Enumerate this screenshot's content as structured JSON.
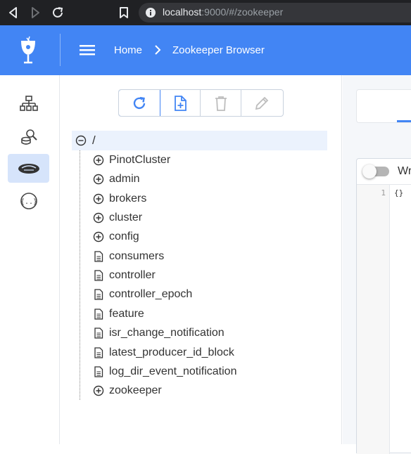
{
  "browser": {
    "url_host": "localhost",
    "url_path": ":9000/#/zookeeper"
  },
  "header": {
    "breadcrumb_home": "Home",
    "breadcrumb_current": "Zookeeper Browser",
    "accent_color": "#4285f4"
  },
  "sidebar": {
    "items": [
      {
        "icon": "cluster-tree-icon",
        "active": false
      },
      {
        "icon": "query-console-icon",
        "active": false
      },
      {
        "icon": "zookeeper-icon",
        "active": true
      },
      {
        "icon": "swagger-api-icon",
        "active": false
      }
    ]
  },
  "toolbar": {
    "buttons": [
      {
        "icon": "refresh-icon",
        "enabled": true
      },
      {
        "icon": "add-file-icon",
        "enabled": true
      },
      {
        "icon": "delete-icon",
        "enabled": false
      },
      {
        "icon": "edit-icon",
        "enabled": false
      }
    ]
  },
  "tree": {
    "root_label": "/",
    "nodes": [
      {
        "label": "PinotCluster",
        "type": "folder"
      },
      {
        "label": "admin",
        "type": "folder"
      },
      {
        "label": "brokers",
        "type": "folder"
      },
      {
        "label": "cluster",
        "type": "folder"
      },
      {
        "label": "config",
        "type": "folder"
      },
      {
        "label": "consumers",
        "type": "file"
      },
      {
        "label": "controller",
        "type": "file"
      },
      {
        "label": "controller_epoch",
        "type": "file"
      },
      {
        "label": "feature",
        "type": "file"
      },
      {
        "label": "isr_change_notification",
        "type": "file"
      },
      {
        "label": "latest_producer_id_block",
        "type": "file"
      },
      {
        "label": "log_dir_event_notification",
        "type": "file"
      },
      {
        "label": "zookeeper",
        "type": "folder"
      }
    ]
  },
  "editor": {
    "wrap_label": "Wr",
    "line_number": "1",
    "content": "{}"
  }
}
